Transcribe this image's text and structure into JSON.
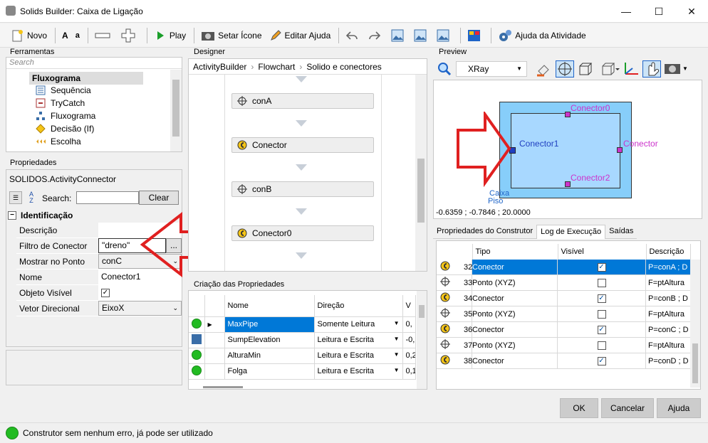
{
  "window": {
    "title": "Solids Builder: Caixa de Ligação"
  },
  "toolbar": {
    "novo": "Novo",
    "bold_a": "A",
    "small_a": "a",
    "play": "Play",
    "set_icon": "Setar Ícone",
    "edit_help": "Editar Ajuda",
    "activity_help": "Ajuda da Atividade"
  },
  "tools": {
    "header": "Ferramentas",
    "search_placeholder": "Search",
    "group": "Fluxograma",
    "items": [
      "Sequência",
      "TryCatch",
      "Fluxograma",
      "Decisão (If)",
      "Escolha"
    ]
  },
  "properties": {
    "header": "Propriedades",
    "type_name": "SOLIDOS.ActivityConnector",
    "search_label": "Search:",
    "search_value": "",
    "clear": "Clear",
    "category": "Identificação",
    "rows": [
      {
        "label": "Descrição",
        "value": ""
      },
      {
        "label": "Filtro de Conector",
        "value": "\"dreno\""
      },
      {
        "label": "Mostrar no Ponto",
        "value": "conC"
      },
      {
        "label": "Nome",
        "value": "Conector1"
      },
      {
        "label": "Objeto Visível",
        "value": "✓"
      },
      {
        "label": "Vetor Direcional",
        "value": "EixoX"
      }
    ],
    "ellipsis": "..."
  },
  "designer": {
    "header": "Designer",
    "breadcrumb": [
      "ActivityBuilder",
      "Flowchart",
      "Solido e conectores"
    ],
    "nodes": [
      "conA",
      "Conector",
      "conB",
      "Conector0"
    ]
  },
  "creation": {
    "header": "Criação das Propriedades",
    "columns": [
      "Nome",
      "Direção",
      "V"
    ],
    "rows": [
      {
        "name": "MaxPipe",
        "dir": "Somente Leitura",
        "v": "0,"
      },
      {
        "name": "SumpElevation",
        "dir": "Leitura e Escrita",
        "v": "-0,"
      },
      {
        "name": "AlturaMin",
        "dir": "Leitura e Escrita",
        "v": "0,2"
      },
      {
        "name": "Folga",
        "dir": "Leitura e Escrita",
        "v": "0,1"
      }
    ]
  },
  "preview": {
    "header": "Preview",
    "mode": "XRay",
    "labels": {
      "c0": "Conector0",
      "c1": "Conector1",
      "c2": "Conector2",
      "c": "Conector",
      "caixa": "Caixa",
      "piso": "Piso"
    },
    "coords": "-0.6359 ; -0.7846 ; 20.0000"
  },
  "log": {
    "tabs": [
      "Propriedades do Construtor",
      "Log de Execução",
      "Saídas"
    ],
    "columns": [
      "",
      "Tipo",
      "Visível",
      "Descrição"
    ],
    "rows": [
      {
        "n": "32",
        "tipo": "Conector",
        "vis": true,
        "desc": "P=conA ; D"
      },
      {
        "n": "33",
        "tipo": "Ponto (XYZ)",
        "vis": false,
        "desc": "F=ptAltura"
      },
      {
        "n": "34",
        "tipo": "Conector",
        "vis": true,
        "desc": "P=conB ; D"
      },
      {
        "n": "35",
        "tipo": "Ponto (XYZ)",
        "vis": false,
        "desc": "F=ptAltura"
      },
      {
        "n": "36",
        "tipo": "Conector",
        "vis": true,
        "desc": "P=conC ; D"
      },
      {
        "n": "37",
        "tipo": "Ponto (XYZ)",
        "vis": false,
        "desc": "F=ptAltura"
      },
      {
        "n": "38",
        "tipo": "Conector",
        "vis": true,
        "desc": "P=conD ; D"
      }
    ]
  },
  "buttons": {
    "ok": "OK",
    "cancel": "Cancelar",
    "help": "Ajuda"
  },
  "status": {
    "text": "Construtor sem nenhum erro, já pode ser utilizado",
    "color": "#22bb22"
  },
  "colors": {
    "selection": "#0078d7",
    "connector": "#cc33cc",
    "preview_fill": "#87cefa"
  }
}
